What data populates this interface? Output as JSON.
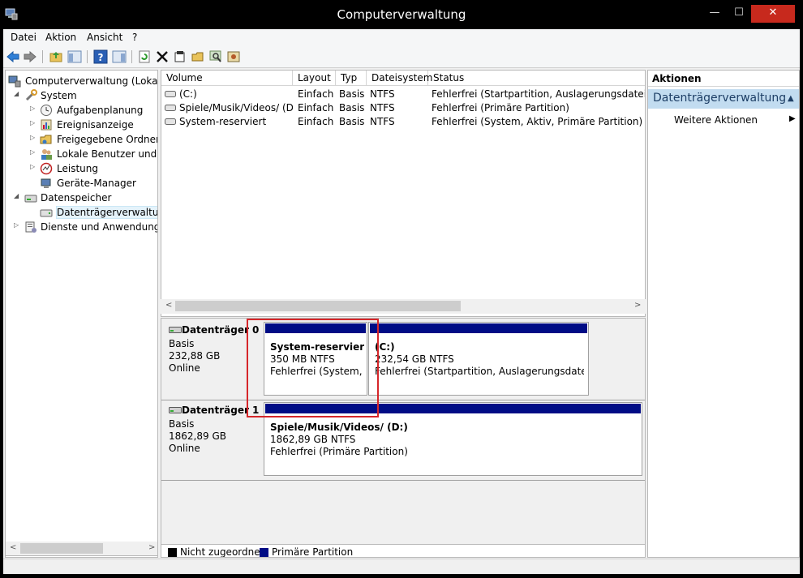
{
  "window": {
    "title": "Computerverwaltung",
    "min_glyph": "—",
    "max_glyph": "☐",
    "close_glyph": "✕"
  },
  "menu": [
    "Datei",
    "Aktion",
    "Ansicht",
    "?"
  ],
  "toolbar_icons": [
    "back-icon",
    "forward-icon",
    "up-folder-icon",
    "console-tree-icon",
    "help-icon",
    "action-pane-icon",
    "refresh-icon",
    "delete-icon",
    "properties-icon",
    "open-icon",
    "search-icon",
    "wizard-icon"
  ],
  "tree": {
    "root": "Computerverwaltung (Lokal)",
    "system": "System",
    "aufgabenplanung": "Aufgabenplanung",
    "ereignisanzeige": "Ereignisanzeige",
    "freigegebene": "Freigegebene Ordner",
    "benutzer": "Lokale Benutzer und Gruppen",
    "leistung": "Leistung",
    "geraete": "Geräte-Manager",
    "datenspeicher": "Datenspeicher",
    "datentraeger": "Datenträgerverwaltung",
    "dienste": "Dienste und Anwendungen"
  },
  "volume_list": {
    "headers": [
      "Volume",
      "Layout",
      "Typ",
      "Dateisystem",
      "Status"
    ],
    "rows": [
      [
        "(C:)",
        "Einfach",
        "Basis",
        "NTFS",
        "Fehlerfrei (Startpartition, Auslagerungsdatei, Absturzabbild, Primäre Partition)"
      ],
      [
        "Spiele/Musik/Videos/ (D:)",
        "Einfach",
        "Basis",
        "NTFS",
        "Fehlerfrei (Primäre Partition)"
      ],
      [
        "System-reserviert",
        "Einfach",
        "Basis",
        "NTFS",
        "Fehlerfrei (System, Aktiv, Primäre Partition)"
      ]
    ]
  },
  "disks": [
    {
      "name": "Datenträger 0",
      "type": "Basis",
      "size": "232,88 GB",
      "state": "Online",
      "partitions": [
        {
          "name": "System-reserviert",
          "size": "350 MB NTFS",
          "status": "Fehlerfrei (System, Aktiv, Primäre Partition)"
        },
        {
          "name": "(C:)",
          "size": "232,54 GB NTFS",
          "status": "Fehlerfrei (Startpartition, Auslagerungsdatei, Absturzabbild, Primäre Partition)"
        }
      ]
    },
    {
      "name": "Datenträger 1",
      "type": "Basis",
      "size": "1862,89 GB",
      "state": "Online",
      "partitions": [
        {
          "name": "Spiele/Musik/Videos/  (D:)",
          "size": "1862,89 GB NTFS",
          "status": "Fehlerfrei (Primäre Partition)"
        }
      ]
    }
  ],
  "legend": {
    "unallocated": "Nicht zugeordnet",
    "primary": "Primäre Partition",
    "unallocated_color": "#000000",
    "primary_color": "#000c85"
  },
  "actions": {
    "header": "Aktionen",
    "section": "Datenträgerverwaltung",
    "more": "Weitere Aktionen"
  },
  "colors": {
    "highlight": "#d6262a",
    "section_bg": "#c2dcf0",
    "close_btn": "#c7291d"
  }
}
